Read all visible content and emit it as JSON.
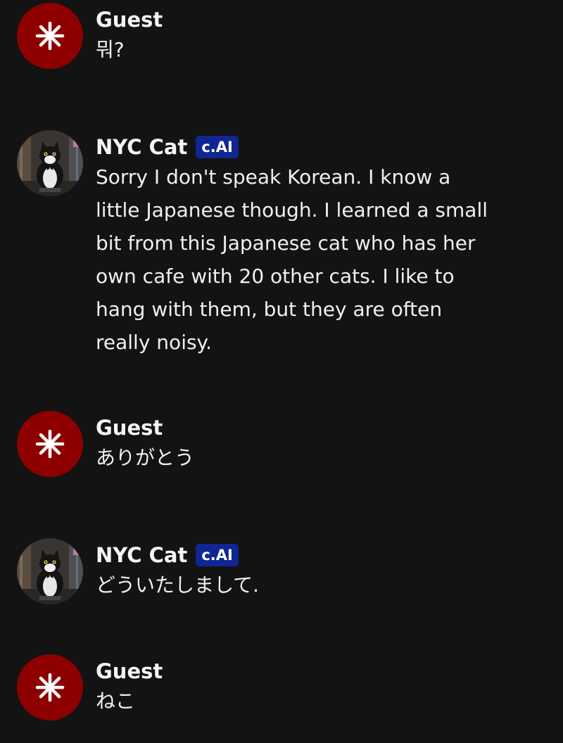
{
  "messages": [
    {
      "sender": "Guest",
      "text": "뭐?"
    },
    {
      "sender": "NYC Cat",
      "badge": "c.AI",
      "text": "Sorry I don't speak Korean. I know a little Japanese though. I learned a small bit from this Japanese cat who has her own cafe with 20 other cats. I like to hang with them, but they are often really noisy."
    },
    {
      "sender": "Guest",
      "text": "ありがとう"
    },
    {
      "sender": "NYC Cat",
      "badge": "c.AI",
      "text": "どういたしまして."
    },
    {
      "sender": "Guest",
      "text": "ねこ"
    }
  ],
  "colors": {
    "background": "#131313",
    "guest_avatar": "#8e0000",
    "badge": "#102693",
    "text": "#f0f0f0"
  },
  "icons": {
    "guest_avatar": "starburst-icon",
    "bot_avatar": "cat-avatar-image"
  }
}
